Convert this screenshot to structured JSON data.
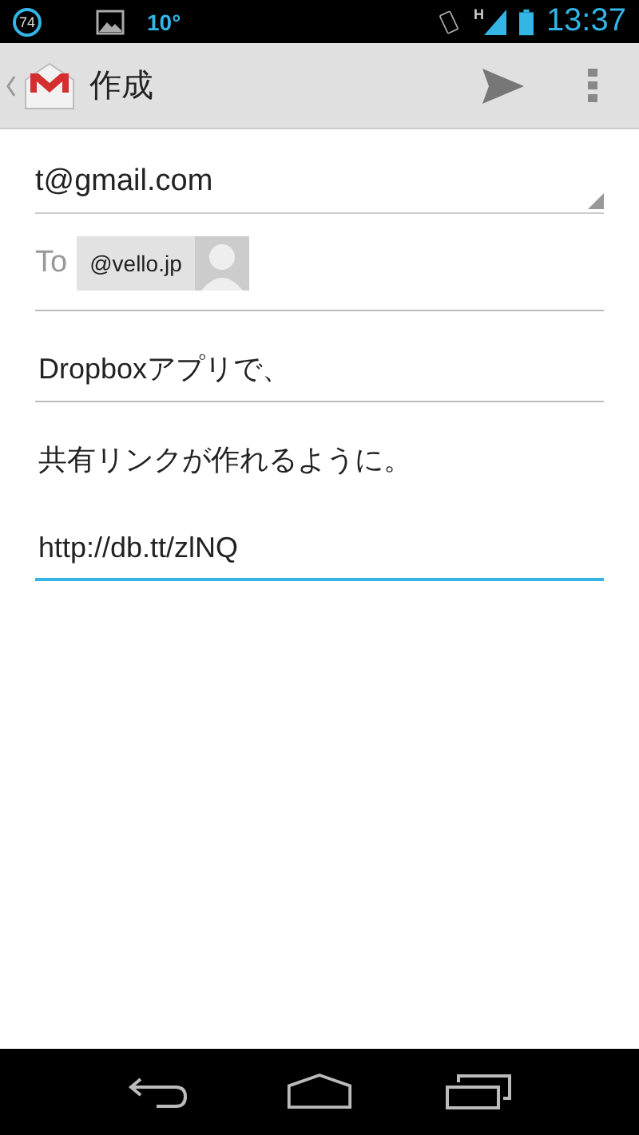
{
  "status_bar": {
    "notification_count": "74",
    "temperature": "10°",
    "network": "H",
    "time": "13:37"
  },
  "action_bar": {
    "title": "作成"
  },
  "compose": {
    "from": "t@gmail.com",
    "to_label": "To",
    "recipients": [
      "@vello.jp"
    ],
    "body_lines": [
      {
        "text": "Dropboxアプリで、",
        "focused": false
      },
      {
        "text": "共有リンクが作れるように。",
        "focused": false
      },
      {
        "text": "http://db.tt/zlNQ",
        "focused": true
      }
    ]
  }
}
